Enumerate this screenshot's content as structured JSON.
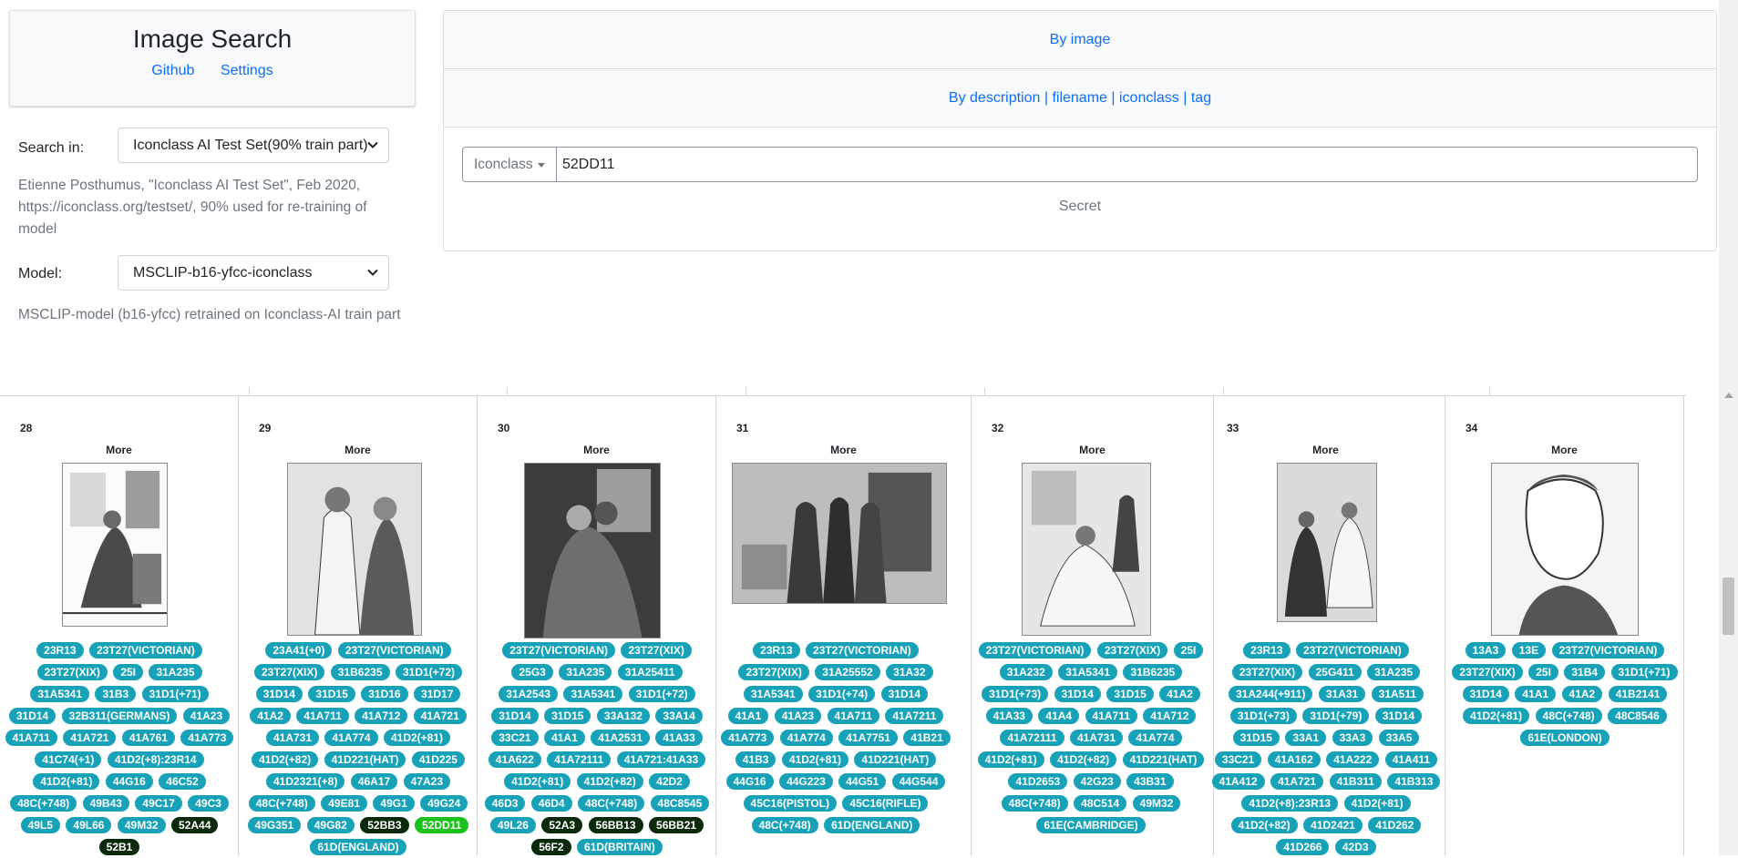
{
  "app": {
    "title": "Image Search",
    "links": [
      "Github",
      "Settings"
    ]
  },
  "search_in": {
    "label": "Search in:",
    "value": "Iconclass AI Test Set(90% train part)",
    "description": "Etienne Posthumus, \"Iconclass AI Test Set\", Feb 2020, https://iconclass.org/testset/, 90% used for re-training of model"
  },
  "model": {
    "label": "Model:",
    "value": "MSCLIP-b16-yfcc-iconclass",
    "description": "MSCLIP-model (b16-yfcc) retrained on Iconclass-AI train part"
  },
  "by_image": "By image",
  "by_description": {
    "parts": [
      "By description",
      "filename",
      "iconclass",
      "tag"
    ],
    "separator": " | "
  },
  "search": {
    "dropdown": "Iconclass",
    "value": "52DD11"
  },
  "secret_label": "Secret",
  "more_label": "More",
  "results": [
    {
      "index": "28",
      "image_icon": "engraving-seated-man-icon",
      "tags": [
        {
          "label": "23R13"
        },
        {
          "label": "23T27(VICTORIAN)"
        },
        {
          "label": "23T27(XIX)"
        },
        {
          "label": "25I"
        },
        {
          "label": "31A235"
        },
        {
          "label": "31A5341"
        },
        {
          "label": "31B3"
        },
        {
          "label": "31D1(+71)"
        },
        {
          "label": "31D14"
        },
        {
          "label": "32B311(GERMANS)"
        },
        {
          "label": "41A23"
        },
        {
          "label": "41A711"
        },
        {
          "label": "41A721"
        },
        {
          "label": "41A761"
        },
        {
          "label": "41A773"
        },
        {
          "label": "41C74(+1)"
        },
        {
          "label": "41D2(+8):23R14"
        },
        {
          "label": "41D2(+81)"
        },
        {
          "label": "44G16"
        },
        {
          "label": "46C52"
        },
        {
          "label": "48C(+748)"
        },
        {
          "label": "49B43"
        },
        {
          "label": "49C17"
        },
        {
          "label": "49C3"
        },
        {
          "label": "49L5"
        },
        {
          "label": "49L66"
        },
        {
          "label": "49M32"
        },
        {
          "label": "52A44",
          "state": "dark"
        },
        {
          "label": "52B1",
          "state": "dark"
        }
      ]
    },
    {
      "index": "29",
      "image_icon": "engraving-two-women-icon",
      "tags": [
        {
          "label": "23A41(+0)"
        },
        {
          "label": "23T27(VICTORIAN)"
        },
        {
          "label": "23T27(XIX)"
        },
        {
          "label": "31B6235"
        },
        {
          "label": "31D1(+72)"
        },
        {
          "label": "31D14"
        },
        {
          "label": "31D15"
        },
        {
          "label": "31D16"
        },
        {
          "label": "31D17"
        },
        {
          "label": "41A2"
        },
        {
          "label": "41A711"
        },
        {
          "label": "41A712"
        },
        {
          "label": "41A721"
        },
        {
          "label": "41A731"
        },
        {
          "label": "41A774"
        },
        {
          "label": "41D2(+81)"
        },
        {
          "label": "41D2(+82)"
        },
        {
          "label": "41D221(HAT)"
        },
        {
          "label": "41D225"
        },
        {
          "label": "41D2321(+8)"
        },
        {
          "label": "46A17"
        },
        {
          "label": "47A23"
        },
        {
          "label": "48C(+748)"
        },
        {
          "label": "49E81"
        },
        {
          "label": "49G1"
        },
        {
          "label": "49G24"
        },
        {
          "label": "49G351"
        },
        {
          "label": "49G82"
        },
        {
          "label": "52BB3",
          "state": "dark"
        },
        {
          "label": "52DD11",
          "state": "green"
        },
        {
          "label": "61D(ENGLAND)"
        }
      ]
    },
    {
      "index": "30",
      "image_icon": "engraving-couple-embracing-icon",
      "tags": [
        {
          "label": "23T27(VICTORIAN)"
        },
        {
          "label": "23T27(XIX)"
        },
        {
          "label": "25G3"
        },
        {
          "label": "31A235"
        },
        {
          "label": "31A25411"
        },
        {
          "label": "31A2543"
        },
        {
          "label": "31A5341"
        },
        {
          "label": "31D1(+72)"
        },
        {
          "label": "31D14"
        },
        {
          "label": "31D15"
        },
        {
          "label": "33A132"
        },
        {
          "label": "33A14"
        },
        {
          "label": "33C21"
        },
        {
          "label": "41A1"
        },
        {
          "label": "41A2531"
        },
        {
          "label": "41A33"
        },
        {
          "label": "41A622"
        },
        {
          "label": "41A72111"
        },
        {
          "label": "41A721:41A33"
        },
        {
          "label": "41D2(+81)"
        },
        {
          "label": "41D2(+82)"
        },
        {
          "label": "42D2"
        },
        {
          "label": "46D3"
        },
        {
          "label": "46D4"
        },
        {
          "label": "48C(+748)"
        },
        {
          "label": "48C8545"
        },
        {
          "label": "49L26"
        },
        {
          "label": "52A3",
          "state": "dark"
        },
        {
          "label": "56BB13",
          "state": "dark"
        },
        {
          "label": "56BB21",
          "state": "dark"
        },
        {
          "label": "56F2",
          "state": "dark"
        },
        {
          "label": "61D(BRITAIN)"
        }
      ]
    },
    {
      "index": "31",
      "image_icon": "engraving-group-of-men-icon",
      "tags": [
        {
          "label": "23R13"
        },
        {
          "label": "23T27(VICTORIAN)"
        },
        {
          "label": "23T27(XIX)"
        },
        {
          "label": "31A25552"
        },
        {
          "label": "31A32"
        },
        {
          "label": "31A5341"
        },
        {
          "label": "31D1(+74)"
        },
        {
          "label": "31D14"
        },
        {
          "label": "41A1"
        },
        {
          "label": "41A23"
        },
        {
          "label": "41A711"
        },
        {
          "label": "41A7211"
        },
        {
          "label": "41A773"
        },
        {
          "label": "41A774"
        },
        {
          "label": "41A7751"
        },
        {
          "label": "41B21"
        },
        {
          "label": "41B3"
        },
        {
          "label": "41D2(+81)"
        },
        {
          "label": "41D221(HAT)"
        },
        {
          "label": "44G16"
        },
        {
          "label": "44G223"
        },
        {
          "label": "44G51"
        },
        {
          "label": "44G544"
        },
        {
          "label": "45C16(PISTOL)"
        },
        {
          "label": "45C16(RIFLE)"
        },
        {
          "label": "48C(+748)"
        },
        {
          "label": "61D(ENGLAND)"
        }
      ]
    },
    {
      "index": "32",
      "image_icon": "engraving-women-in-parlour-icon",
      "tags": [
        {
          "label": "23T27(VICTORIAN)"
        },
        {
          "label": "23T27(XIX)"
        },
        {
          "label": "25I"
        },
        {
          "label": "31A232"
        },
        {
          "label": "31A5341"
        },
        {
          "label": "31B6235"
        },
        {
          "label": "31D1(+73)"
        },
        {
          "label": "31D14"
        },
        {
          "label": "31D15"
        },
        {
          "label": "41A2"
        },
        {
          "label": "41A33"
        },
        {
          "label": "41A4"
        },
        {
          "label": "41A711"
        },
        {
          "label": "41A712"
        },
        {
          "label": "41A72111"
        },
        {
          "label": "41A731"
        },
        {
          "label": "41A774"
        },
        {
          "label": "41D2(+81)"
        },
        {
          "label": "41D2(+82)"
        },
        {
          "label": "41D221(HAT)"
        },
        {
          "label": "41D2653"
        },
        {
          "label": "42G23"
        },
        {
          "label": "43B31"
        },
        {
          "label": "48C(+748)"
        },
        {
          "label": "48C514"
        },
        {
          "label": "49M32"
        },
        {
          "label": "61E(CAMBRIDGE)"
        }
      ]
    },
    {
      "index": "33",
      "image_icon": "engraving-ladies-in-gowns-icon",
      "tags": [
        {
          "label": "23R13"
        },
        {
          "label": "23T27(VICTORIAN)"
        },
        {
          "label": "23T27(XIX)"
        },
        {
          "label": "25G411"
        },
        {
          "label": "31A235"
        },
        {
          "label": "31A244(+911)"
        },
        {
          "label": "31A31"
        },
        {
          "label": "31A511"
        },
        {
          "label": "31D1(+73)"
        },
        {
          "label": "31D1(+79)"
        },
        {
          "label": "31D14"
        },
        {
          "label": "31D15"
        },
        {
          "label": "33A1"
        },
        {
          "label": "33A3"
        },
        {
          "label": "33A5"
        },
        {
          "label": "33C21"
        },
        {
          "label": "41A162"
        },
        {
          "label": "41A222"
        },
        {
          "label": "41A411"
        },
        {
          "label": "41A412"
        },
        {
          "label": "41A721"
        },
        {
          "label": "41B311"
        },
        {
          "label": "41B313"
        },
        {
          "label": "41D2(+8):23R13"
        },
        {
          "label": "41D2(+81)"
        },
        {
          "label": "41D2(+82)"
        },
        {
          "label": "41D2421"
        },
        {
          "label": "41D262"
        },
        {
          "label": "41D266"
        },
        {
          "label": "42D3"
        }
      ]
    },
    {
      "index": "34",
      "image_icon": "engraving-portrait-man-icon",
      "tags": [
        {
          "label": "13A3"
        },
        {
          "label": "13E"
        },
        {
          "label": "23T27(VICTORIAN)"
        },
        {
          "label": "23T27(XIX)"
        },
        {
          "label": "25I"
        },
        {
          "label": "31B4"
        },
        {
          "label": "31D1(+71)"
        },
        {
          "label": "31D14"
        },
        {
          "label": "41A1"
        },
        {
          "label": "41A2"
        },
        {
          "label": "41B2141"
        },
        {
          "label": "41D2(+81)"
        },
        {
          "label": "48C(+748)"
        },
        {
          "label": "48C8546"
        },
        {
          "label": "61E(LONDON)"
        }
      ]
    }
  ]
}
